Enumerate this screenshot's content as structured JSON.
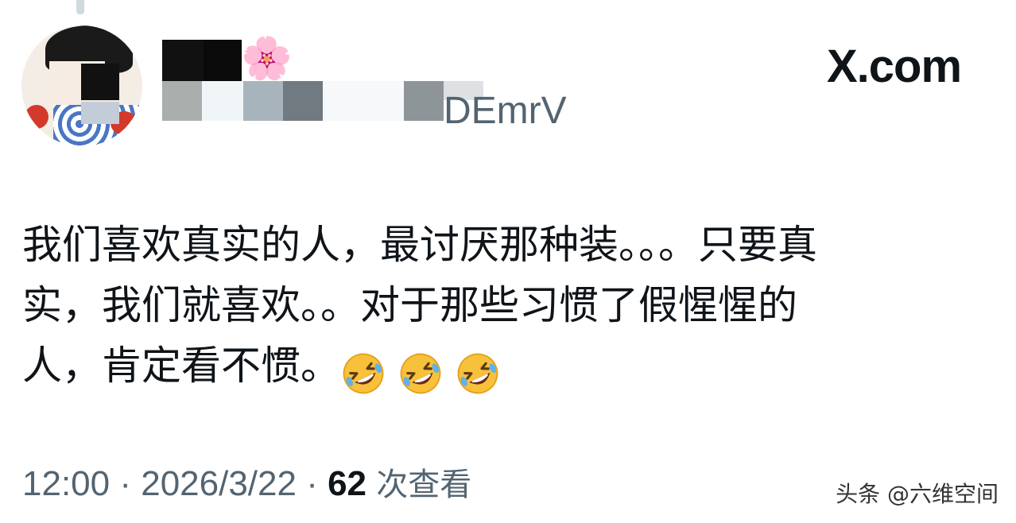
{
  "header": {
    "brand_logo": "X.com",
    "handle_visible_tail": "DEmrV",
    "name_emoji": "🌸"
  },
  "tweet": {
    "lines": [
      "我们喜欢真实的人，最讨厌那种装。。。只要真",
      "实，我们就喜欢。。对于那些习惯了假惺惺的",
      "人，肯定看不惯。"
    ],
    "emojis": [
      "rolling-on-floor-laughing-emoji",
      "rolling-on-floor-laughing-emoji",
      "rolling-on-floor-laughing-emoji"
    ]
  },
  "meta": {
    "time": "12:00",
    "separator": " · ",
    "date": "2026/3/22",
    "view_count": "62",
    "view_label": "次查看"
  },
  "watermark": "头条 @六维空间",
  "colors": {
    "text_primary": "#0f1419",
    "text_secondary": "#536471",
    "background": "#ffffff"
  }
}
